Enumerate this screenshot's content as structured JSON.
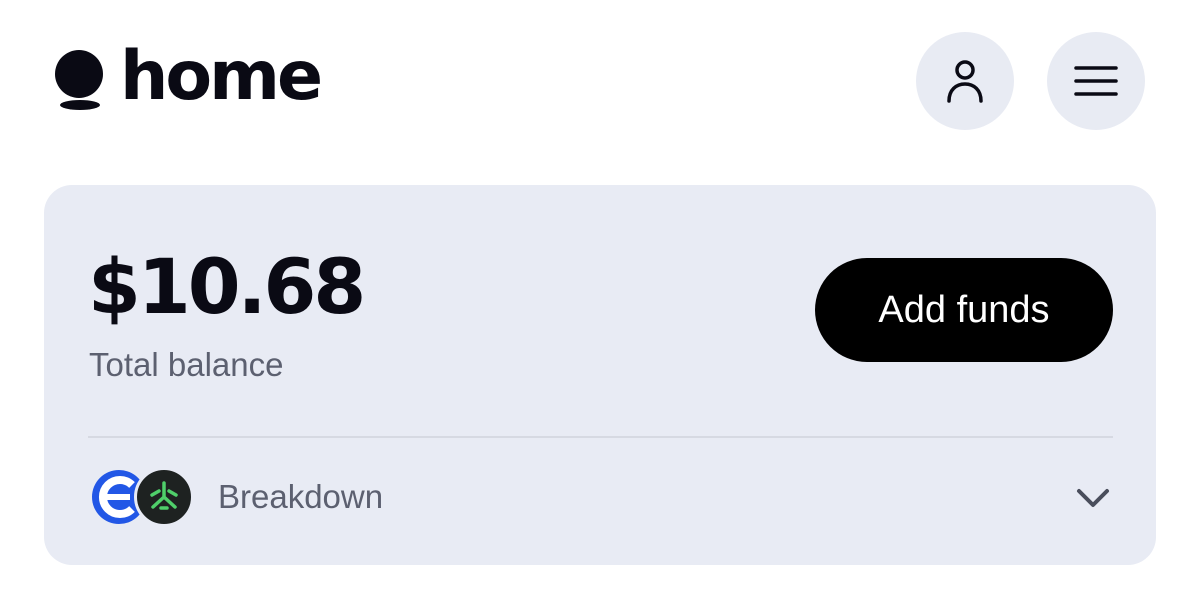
{
  "header": {
    "logo_text": "home",
    "profile_button": "profile",
    "menu_button": "menu"
  },
  "balance_card": {
    "amount": "$10.68",
    "label": "Total balance",
    "add_funds_label": "Add funds",
    "breakdown_label": "Breakdown"
  },
  "icons": {
    "logo": "home-logo-icon",
    "profile": "user-icon",
    "menu": "hamburger-menu-icon",
    "token_one": "blue-e-token-icon",
    "token_two": "green-tripod-token-icon",
    "expand": "chevron-down-icon"
  },
  "colors": {
    "card_background": "#e8ebf4",
    "button_background": "#000000",
    "round_button_background": "#e8ebf3",
    "text_primary": "#0a0a14",
    "text_secondary": "#5c6070",
    "token_blue": "#2257e6",
    "token_green": "#4fcf6a"
  }
}
